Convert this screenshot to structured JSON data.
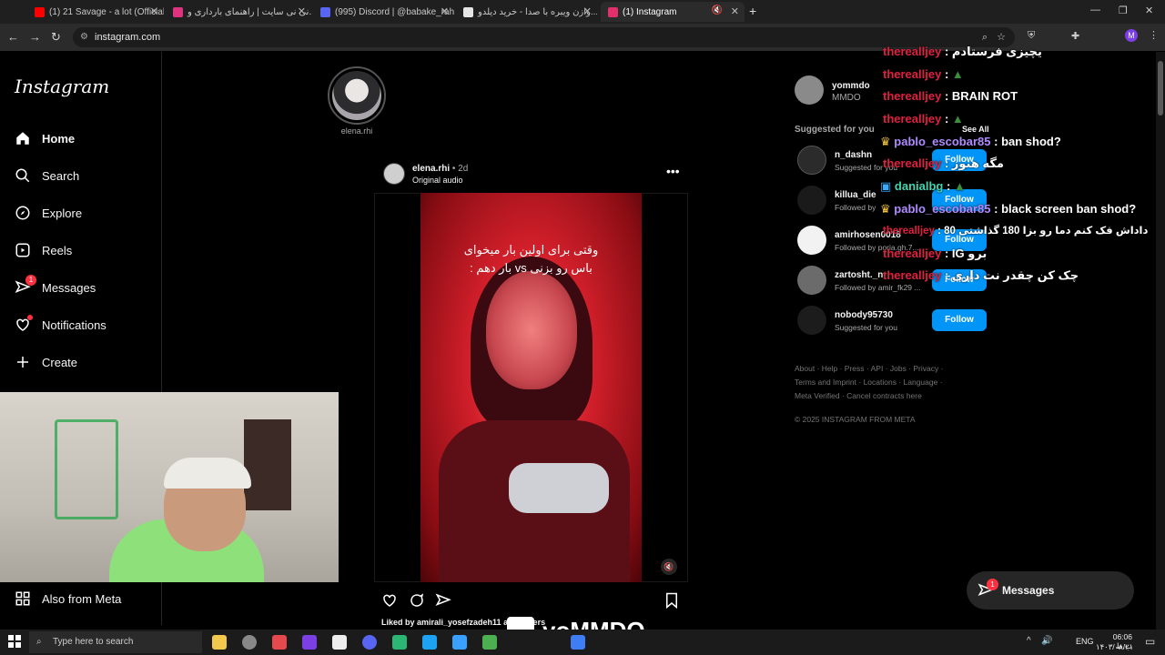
{
  "browser": {
    "tabs": [
      {
        "label": "(1) 21 Savage - a lot (Official Vi...",
        "color": "#ff0000"
      },
      {
        "label": "نی نی سایت | راهنمای بارداری و...",
        "color": "#e0337f"
      },
      {
        "label": "(995) Discord | @babake_rahn...",
        "color": "#5865f2"
      },
      {
        "label": "وازن ویبره با صدا - خرید دیلدو...",
        "color": "#e5e5e5"
      },
      {
        "label": "(1) Instagram",
        "color": "#e1306c"
      }
    ],
    "url": "instagram.com",
    "new_tab": "+"
  },
  "sidebar": {
    "logo": "Instagram",
    "items": [
      {
        "label": "Home",
        "icon": "home-icon"
      },
      {
        "label": "Search",
        "icon": "search-icon"
      },
      {
        "label": "Explore",
        "icon": "compass-icon"
      },
      {
        "label": "Reels",
        "icon": "reels-icon"
      },
      {
        "label": "Messages",
        "icon": "messenger-icon",
        "badge": "1"
      },
      {
        "label": "Notifications",
        "icon": "heart-icon"
      },
      {
        "label": "Create",
        "icon": "plus-icon"
      }
    ],
    "also_from_meta": "Also from Meta"
  },
  "feed": {
    "story_username": "elena.rhi",
    "post": {
      "username": "elena.rhi",
      "time": "• 2d",
      "audio": "Original audio",
      "overlay_line1": "وقتی برای اولین بار میخوای",
      "overlay_line2": "باس رو بزنی vs بار دهم :",
      "liked_by": "Liked by amirali_yosefzadeh11 and others"
    }
  },
  "right": {
    "me": {
      "username": "yommdo",
      "name": "MMDO"
    },
    "suggested_title": "Suggested for you",
    "see_all": "See All",
    "suggestions": [
      {
        "username": "n_dashn",
        "sub": "Suggested for you",
        "follow": "Follow"
      },
      {
        "username": "killua_die",
        "sub": "Followed by",
        "follow": "Follow"
      },
      {
        "username": "amirhosen0018",
        "sub": "Followed by poria.gh.7...",
        "follow": "Follow"
      },
      {
        "username": "zartosht._n",
        "sub": "Followed by amir_fk29 ...",
        "follow": "Follow"
      },
      {
        "username": "nobody95730",
        "sub": "Suggested for you",
        "follow": "Follow"
      }
    ],
    "footer_line1": "About · Help · Press · API · Jobs · Privacy ·",
    "footer_line2": "Terms and Imprint · Locations · Language ·",
    "footer_line3": "Meta Verified · Cancel contracts here",
    "copyright": "© 2025 INSTAGRAM FROM META"
  },
  "chat": [
    {
      "user": "therealljey",
      "text": ": یچیزی فرستادم"
    },
    {
      "user": "therealljey",
      "text": ":"
    },
    {
      "user": "therealljey",
      "text": ": BRAIN ROT"
    },
    {
      "user": "therealljey",
      "text": ":"
    },
    {
      "user": "pablo_escobar85",
      "text": ": ban shod?"
    },
    {
      "user": "therealljey",
      "text": ": مگه هنوز"
    },
    {
      "user": "danialbg",
      "text": ":"
    },
    {
      "user": "pablo_escobar85",
      "text": ": black screen ban shod?"
    },
    {
      "user": "therealljey",
      "text": ": داداش فک کنم دما رو بزا 180 گذاشتی 80"
    },
    {
      "user": "therealljey",
      "text": ": IG برو"
    },
    {
      "user": "therealljey",
      "text": ": چک کن چقدر نت داری"
    }
  ],
  "messages_pill": {
    "label": "Messages",
    "badge": "1"
  },
  "watermark": "yoMMDO",
  "taskbar": {
    "search_placeholder": "Type here to search",
    "lang": "ENG",
    "time": "06:06 ب.ظ",
    "date": "۱۴۰۳/۰۸/۲۱"
  },
  "colors": {
    "accent": "#0095f6",
    "badge": "#ff3040",
    "chat_user": "#e0203f"
  }
}
